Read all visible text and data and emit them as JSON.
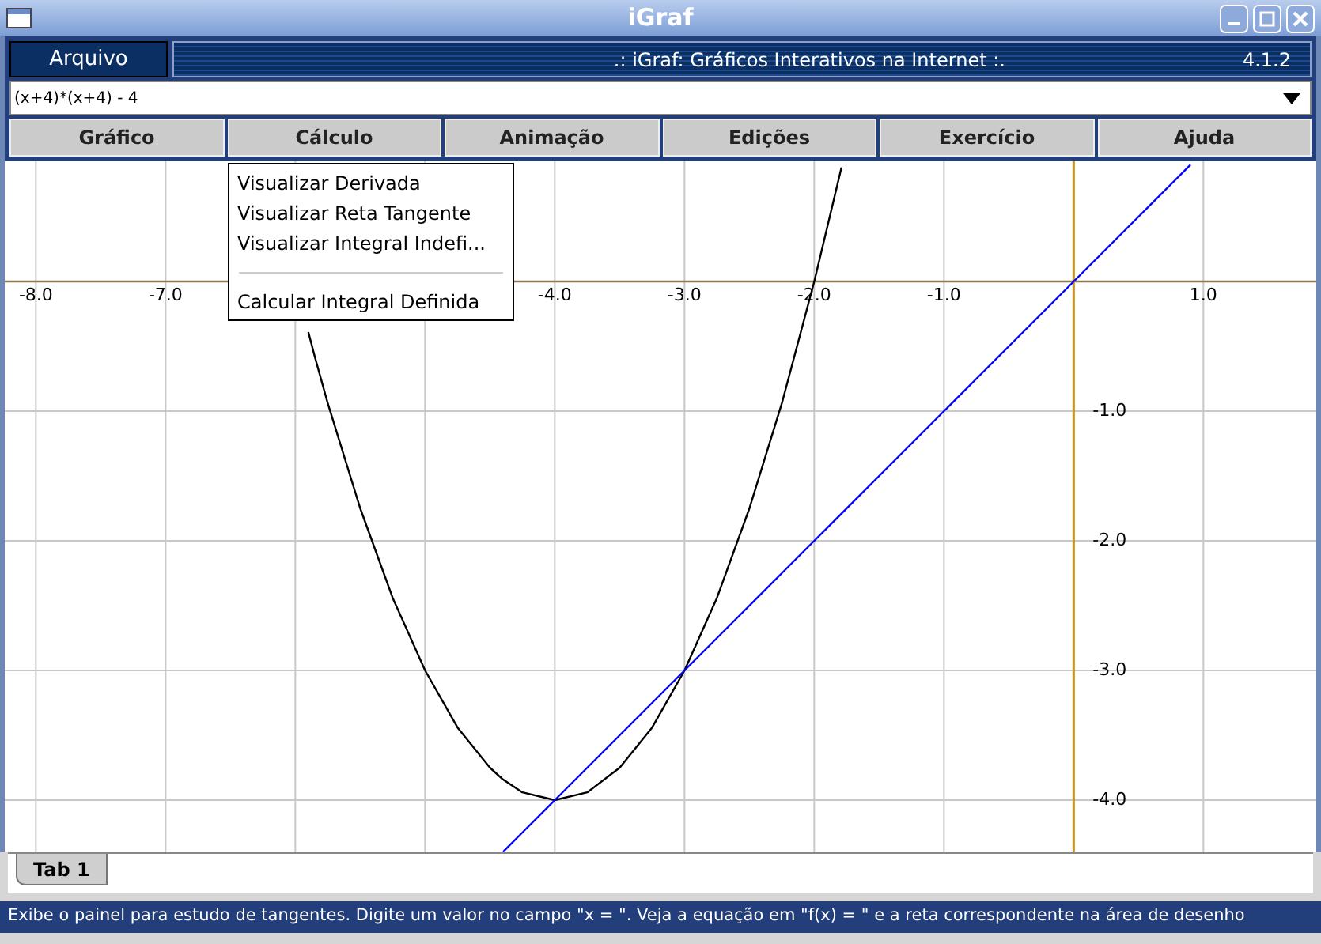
{
  "window": {
    "title": "iGraf"
  },
  "file_menu": {
    "label": "Arquivo"
  },
  "banner": {
    "title": ".: iGraf: Gráficos Interativos na Internet :.",
    "version": "4.1.2"
  },
  "function_field": {
    "value": "(x+4)*(x+4) - 4"
  },
  "toolbar": [
    {
      "label": "Gráfico"
    },
    {
      "label": "Cálculo"
    },
    {
      "label": "Animação"
    },
    {
      "label": "Edições"
    },
    {
      "label": "Exercício"
    },
    {
      "label": "Ajuda"
    }
  ],
  "dropdown_menu": [
    {
      "kind": "item",
      "label": "Visualizar Derivada"
    },
    {
      "kind": "item",
      "label": "Visualizar Reta Tangente"
    },
    {
      "kind": "item",
      "label": "Visualizar Integral Indefi..."
    },
    {
      "kind": "separator"
    },
    {
      "kind": "item",
      "label": "Calcular Integral Definida"
    }
  ],
  "graph": {
    "chart_data": {
      "type": "line",
      "x": [
        -5.9,
        -5.85,
        -5.75,
        -5.5,
        -5.25,
        -5,
        -4.75,
        -4.5,
        -4.4,
        -4.25,
        -4,
        -3.75,
        -3.5,
        -3.25,
        -3,
        -2.75,
        -2.5,
        -2.25,
        -2,
        -1.79,
        -1.5,
        -1.25,
        -1,
        -0.75,
        -0.5,
        -0.25,
        0,
        0.25,
        0.5,
        0.75,
        0.9
      ],
      "series": [
        {
          "color": "#000000",
          "values": [
            -0.39,
            -0.58,
            -0.94,
            -1.75,
            -2.44,
            -3,
            -3.44,
            -3.75,
            -3.84,
            -3.94,
            -4,
            -3.94,
            -3.75,
            -3.44,
            -3,
            -2.44,
            -1.75,
            -0.94,
            0,
            0.88,
            null,
            null,
            null,
            null,
            null,
            null,
            null,
            null,
            null,
            null,
            null
          ]
        },
        {
          "color": "#0000ff",
          "values": [
            null,
            null,
            null,
            null,
            null,
            null,
            null,
            null,
            -4.4,
            -4.25,
            -4,
            -3.75,
            -3.5,
            -3.25,
            -3,
            -2.75,
            -2.5,
            -2.25,
            -2,
            -1.79,
            -1.5,
            -1.25,
            -1,
            -0.75,
            -0.5,
            -0.25,
            0,
            0.25,
            0.5,
            0.75,
            0.9
          ]
        }
      ],
      "xlim": [
        -8.24,
        1.87
      ],
      "ylim": [
        -4.402,
        0.927
      ],
      "grid": true,
      "xticks": [
        {
          "value": -8,
          "label": "-8.0"
        },
        {
          "value": -7,
          "label": "-7.0"
        },
        {
          "value": -4,
          "label": "-4.0"
        },
        {
          "value": -3,
          "label": "-3.0"
        },
        {
          "value": -2,
          "label": "-2.0"
        },
        {
          "value": -1,
          "label": "-1.0"
        },
        {
          "value": 1,
          "label": "1.0"
        }
      ],
      "yticks": [
        {
          "value": -1,
          "label": "-1.0"
        },
        {
          "value": -2,
          "label": "-2.0"
        },
        {
          "value": -3,
          "label": "-3.0"
        },
        {
          "value": -4,
          "label": "-4.0"
        }
      ]
    }
  },
  "tabs": [
    {
      "label": "Tab 1"
    }
  ],
  "status_bar": "Exibe o painel para estudo de tangentes. Digite um valor no campo \"x = \". Veja a equação em \"f(x) = \" e a reta correspondente na área de desenho"
}
